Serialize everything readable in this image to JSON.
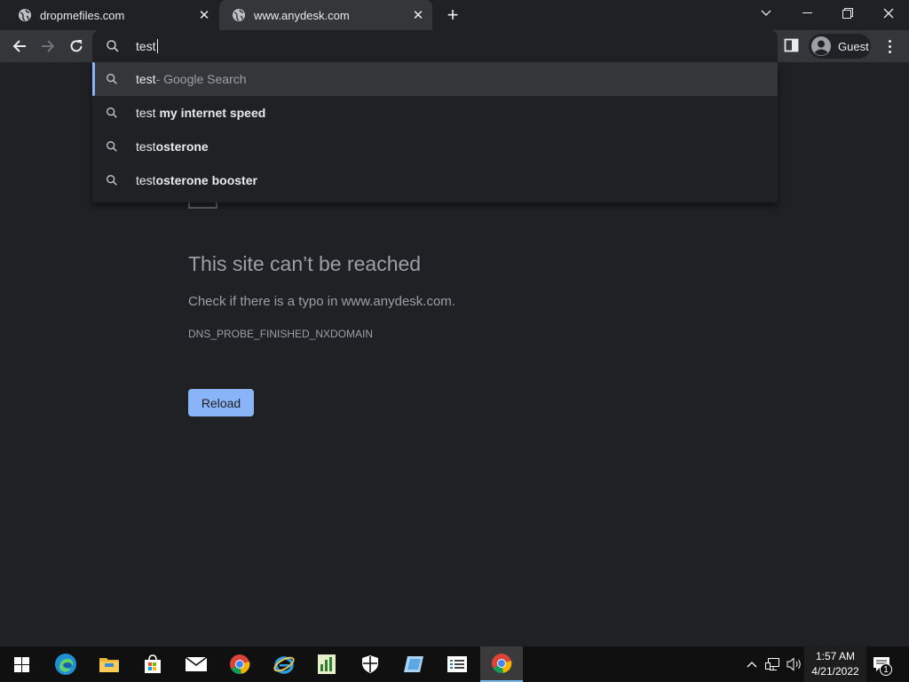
{
  "tabs": [
    {
      "title": "dropmefiles.com",
      "active": false
    },
    {
      "title": "www.anydesk.com",
      "active": true
    }
  ],
  "toolbar": {
    "omnibox_value": "test",
    "profile_name": "Guest"
  },
  "suggestions": [
    {
      "prefix": "test",
      "bold": "",
      "suffix": " - Google Search",
      "selected": true
    },
    {
      "prefix": "test ",
      "bold": "my internet speed",
      "suffix": "",
      "selected": false
    },
    {
      "prefix": "test",
      "bold": "osterone",
      "suffix": "",
      "selected": false
    },
    {
      "prefix": "test",
      "bold": "osterone booster",
      "suffix": "",
      "selected": false
    }
  ],
  "error_page": {
    "title": "This site can’t be reached",
    "message": "Check if there is a typo in www.anydesk.com.",
    "code": "DNS_PROBE_FINISHED_NXDOMAIN",
    "reload_label": "Reload"
  },
  "taskbar": {
    "apps": [
      "start",
      "edge",
      "file-explorer",
      "microsoft-store",
      "mail",
      "chrome",
      "internet-explorer",
      "app-green",
      "windows-security",
      "app-blue",
      "app-list",
      "chrome-active"
    ],
    "time": "1:57 AM",
    "date": "4/21/2022",
    "notification_count": "1"
  },
  "colors": {
    "accent": "#8ab4f8",
    "background": "#202124",
    "toolbar": "#35363a"
  }
}
